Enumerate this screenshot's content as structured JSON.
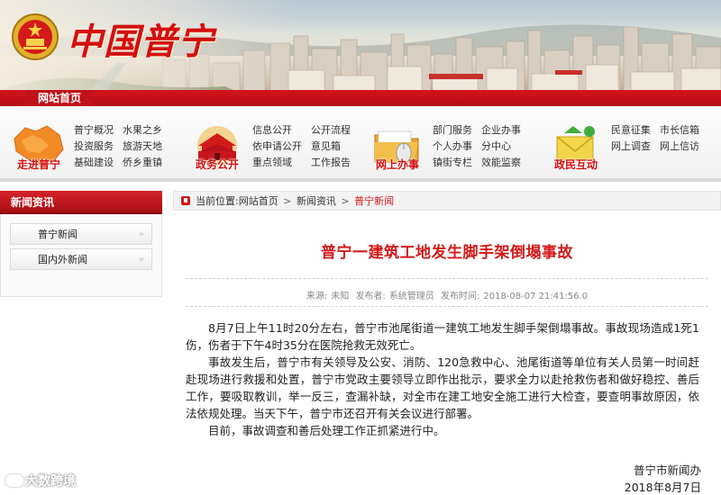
{
  "header": {
    "logo_text": "中国普宁",
    "home_tab": "网站首页"
  },
  "nav": [
    {
      "caption": "走进普宁",
      "icon": "map-icon",
      "links": [
        "普宁概况",
        "水果之乡",
        "投资服务",
        "旅游天地",
        "基础建设",
        "侨乡重镇"
      ]
    },
    {
      "caption": "政务公开",
      "icon": "tiananmen-icon",
      "links": [
        "信息公开",
        "公开流程",
        "依申请公开",
        "意见箱",
        "重点领域",
        "工作报告"
      ]
    },
    {
      "caption": "网上办事",
      "icon": "folder-mouse-icon",
      "links": [
        "部门服务",
        "企业办事",
        "个人办事",
        "分中心",
        "镇街专栏",
        "效能监察"
      ]
    },
    {
      "caption": "政民互动",
      "icon": "envelope-icon",
      "links": [
        "民意征集",
        "市长信箱",
        "网上调查",
        "网上信访"
      ]
    }
  ],
  "sidebar": {
    "title": "新闻资讯",
    "items": [
      {
        "label": "普宁新闻"
      },
      {
        "label": "国内外新闻"
      }
    ],
    "arrow": "»"
  },
  "breadcrumb": {
    "prefix": "当前位置:",
    "items": [
      "网站首页",
      "新闻资讯",
      "普宁新闻"
    ],
    "separator": ">"
  },
  "article": {
    "title": "普宁一建筑工地发生脚手架倒塌事故",
    "meta": {
      "source_label": "来源:",
      "source": "未知",
      "publisher_label": "发布者:",
      "publisher": "系统管理员",
      "time_label": "发布时间:",
      "time": "2018-08-07 21:41:56.0"
    },
    "paragraphs": [
      "8月7日上午11时20分左右，普宁市池尾街道一建筑工地发生脚手架倒塌事故。事故现场造成1死1伤，伤者于下午4时35分在医院抢救无效死亡。",
      "事故发生后，普宁市有关领导及公安、消防、120急救中心、池尾街道等单位有关人员第一时间赶赴现场进行救援和处置，普宁市党政主要领导立即作出批示，要求全力以赴抢救伤者和做好稳控、善后工作，要吸取教训，举一反三，查漏补缺，对全市在建工地安全施工进行大检查，要查明事故原因，依法依规处理。当天下午，普宁市还召开有关会议进行部署。",
      "目前，事故调查和善后处理工作正抓紧进行中。"
    ],
    "signature": "普宁市新闻办",
    "date": "2018年8月7日"
  },
  "watermark": {
    "text": "大数跨境"
  },
  "colors": {
    "accent_red": "#d21a1a",
    "bar_red": "#c0121a"
  }
}
